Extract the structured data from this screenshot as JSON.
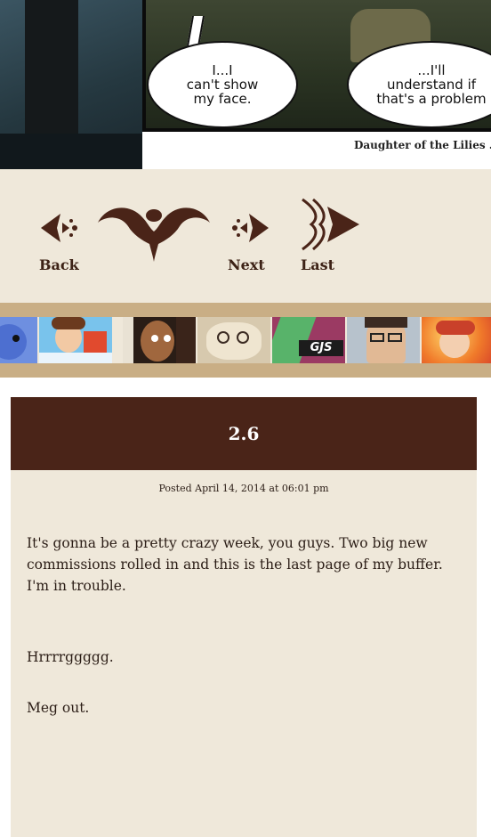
{
  "comic": {
    "bubble_left": "I...I\ncan't show\nmy face.",
    "bubble_right": "...I'll\nunderstand if\nthat's a problem",
    "credit": "Daughter of the Lilies . c"
  },
  "nav": {
    "back_label": "Back",
    "next_label": "Next",
    "last_label": "Last"
  },
  "archive_thumbs": [
    {
      "name": "blue-creature",
      "color": "#5a7fd6"
    },
    {
      "name": "kid-hero",
      "color": "#5fb4e8"
    },
    {
      "name": "girl-braids",
      "color": "#8b5a3c"
    },
    {
      "name": "sheep-glasses",
      "color": "#c9b79a"
    },
    {
      "name": "gjs-logo",
      "color": "#b44a6c"
    },
    {
      "name": "man-glasses",
      "color": "#9aa7b3"
    },
    {
      "name": "redhead",
      "color": "#e8783a"
    }
  ],
  "post": {
    "title": "2.6",
    "meta": "Posted April 14, 2014 at 06:01 pm",
    "paragraph_1": "It's gonna be a pretty crazy week, you guys. Two big new commissions rolled in and this is the last page of my buffer. I'm in trouble.",
    "paragraph_2": "Hrrrrggggg.",
    "paragraph_3": "Meg out."
  },
  "colors": {
    "nav_bg": "#efe8da",
    "ornament": "#4a2418",
    "header_bg": "#4a2418",
    "strip_border": "#c9ae85"
  }
}
